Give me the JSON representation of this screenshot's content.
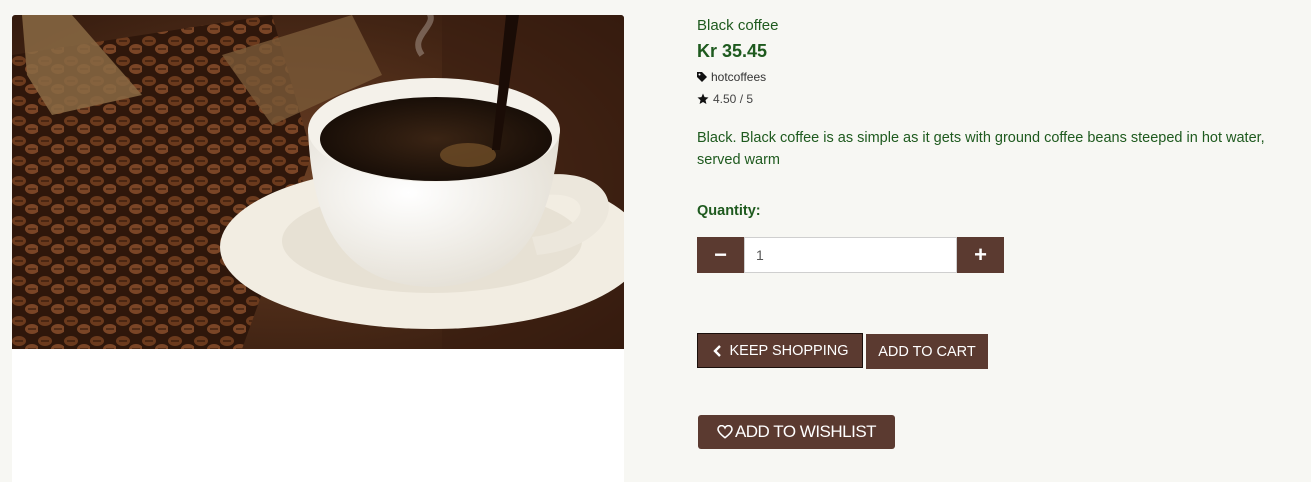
{
  "product": {
    "name": "Black coffee",
    "price": "Kr 35.45",
    "category": "hotcoffees",
    "rating": "4.50 / 5",
    "description": "Black. Black coffee is as simple as it gets with ground coffee beans steeped in hot water, served warm"
  },
  "quantity": {
    "label": "Quantity:",
    "value": "1",
    "decrement_symbol": "−",
    "increment_symbol": "+"
  },
  "actions": {
    "keep_shopping": "Keep Shopping",
    "add_to_cart": "Add to Cart",
    "add_to_wishlist": "Add to Wishlist"
  },
  "icons": {
    "tag": "tag-icon",
    "rating": "star-icon",
    "back": "chevron-left-icon",
    "wishlist": "heart-icon"
  },
  "colors": {
    "accent": "#5b3a30",
    "text_green": "#1e5a1e",
    "page_background": "#f7f7f3"
  }
}
